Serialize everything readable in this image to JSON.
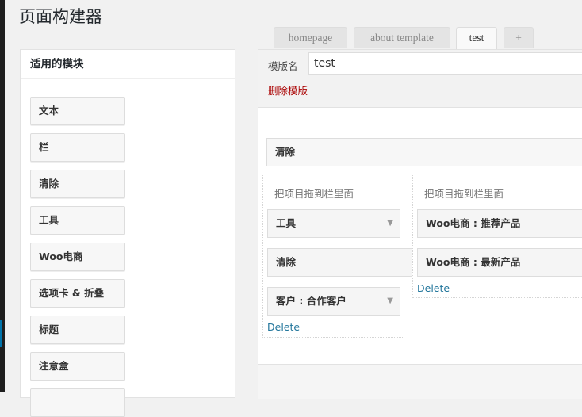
{
  "page": {
    "title": "页面构建器"
  },
  "tabs": [
    {
      "label": "homepage",
      "active": false
    },
    {
      "label": "about template",
      "active": false
    },
    {
      "label": "test",
      "active": true
    },
    {
      "label": "+",
      "active": false
    }
  ],
  "modules_panel": {
    "title": "适用的模块",
    "items": [
      {
        "label": "文本"
      },
      {
        "label": "栏"
      },
      {
        "label": "清除"
      },
      {
        "label": "工具"
      },
      {
        "label": "Woo电商"
      },
      {
        "label": "选项卡 & 折叠"
      },
      {
        "label": "标题"
      },
      {
        "label": "注意盒"
      }
    ]
  },
  "template": {
    "name_label": "模版名",
    "name_value": "test",
    "delete_label": "删除模版"
  },
  "canvas": {
    "top_item": "清除",
    "columns": [
      {
        "hint": "把项目拖到栏里面",
        "items": [
          {
            "label": "工具",
            "dropdown": true
          },
          {
            "label": "清除",
            "dropdown": false
          },
          {
            "label": "客户 : 合作客户",
            "dropdown": true
          }
        ],
        "delete_label": "Delete"
      },
      {
        "hint": "把项目拖到栏里面",
        "items": [
          {
            "label": "Woo电商 : 推荐产品",
            "dropdown": false
          },
          {
            "label": "Woo电商 : 最新产品",
            "dropdown": false
          }
        ],
        "delete_label": "Delete"
      }
    ]
  },
  "icons": {
    "dropdown": "triangle-down-icon"
  }
}
